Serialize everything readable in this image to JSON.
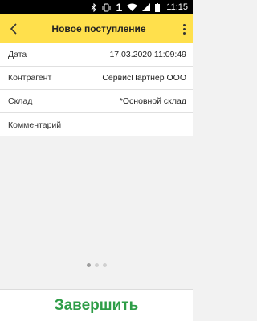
{
  "status_bar": {
    "sim_indicator": "1",
    "time": "11:15",
    "icons": [
      "bluetooth-icon",
      "vibrate-icon",
      "wifi-icon",
      "signal-icon",
      "battery-icon"
    ]
  },
  "app_bar": {
    "title": "Новое поступление",
    "back_icon": "back-arrow-icon",
    "menu_icon": "more-vert-icon",
    "accent_color": "#ffe04c"
  },
  "form": {
    "fields": [
      {
        "label": "Дата",
        "value": "17.03.2020 11:09:49"
      },
      {
        "label": "Контрагент",
        "value": "СервисПартнер ООО"
      },
      {
        "label": "Склад",
        "value": "*Основной склад"
      },
      {
        "label": "Комментарий",
        "value": ""
      }
    ]
  },
  "pager": {
    "pages": 3,
    "active": 1
  },
  "footer": {
    "finish_label": "Завершить",
    "finish_color": "#2e9d47"
  }
}
